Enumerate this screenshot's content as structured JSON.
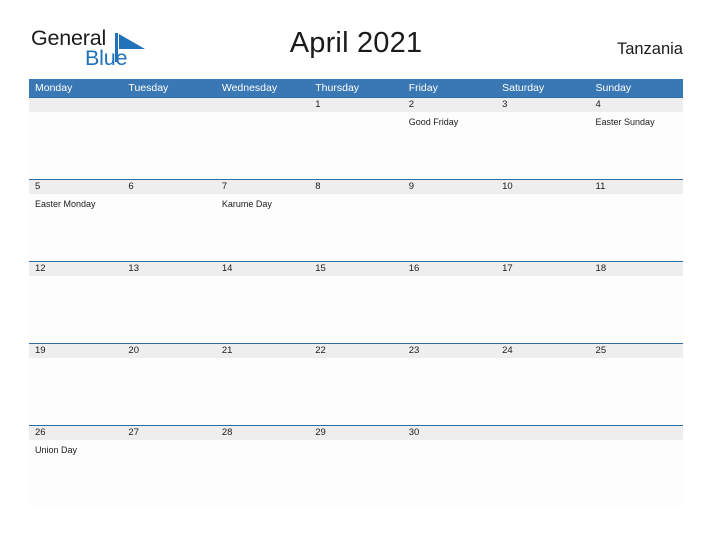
{
  "brand": {
    "name_part1": "General",
    "name_part2": "Blue",
    "mark": "triangle-icon",
    "accent_color": "#2272b9"
  },
  "header": {
    "title": "April 2021",
    "country": "Tanzania"
  },
  "theme": {
    "header_blue": "#3a77b5",
    "row_divider_blue": "#2e6da4",
    "date_strip_gray": "#eeeeee"
  },
  "calendar": {
    "weekdays": [
      "Monday",
      "Tuesday",
      "Wednesday",
      "Thursday",
      "Friday",
      "Saturday",
      "Sunday"
    ],
    "weeks": [
      {
        "days": [
          {
            "number": "",
            "event": ""
          },
          {
            "number": "",
            "event": ""
          },
          {
            "number": "",
            "event": ""
          },
          {
            "number": "1",
            "event": ""
          },
          {
            "number": "2",
            "event": "Good Friday"
          },
          {
            "number": "3",
            "event": ""
          },
          {
            "number": "4",
            "event": "Easter Sunday"
          }
        ]
      },
      {
        "days": [
          {
            "number": "5",
            "event": "Easter Monday"
          },
          {
            "number": "6",
            "event": ""
          },
          {
            "number": "7",
            "event": "Karume Day"
          },
          {
            "number": "8",
            "event": ""
          },
          {
            "number": "9",
            "event": ""
          },
          {
            "number": "10",
            "event": ""
          },
          {
            "number": "11",
            "event": ""
          }
        ]
      },
      {
        "days": [
          {
            "number": "12",
            "event": ""
          },
          {
            "number": "13",
            "event": ""
          },
          {
            "number": "14",
            "event": ""
          },
          {
            "number": "15",
            "event": ""
          },
          {
            "number": "16",
            "event": ""
          },
          {
            "number": "17",
            "event": ""
          },
          {
            "number": "18",
            "event": ""
          }
        ]
      },
      {
        "days": [
          {
            "number": "19",
            "event": ""
          },
          {
            "number": "20",
            "event": ""
          },
          {
            "number": "21",
            "event": ""
          },
          {
            "number": "22",
            "event": ""
          },
          {
            "number": "23",
            "event": ""
          },
          {
            "number": "24",
            "event": ""
          },
          {
            "number": "25",
            "event": ""
          }
        ]
      },
      {
        "days": [
          {
            "number": "26",
            "event": "Union Day"
          },
          {
            "number": "27",
            "event": ""
          },
          {
            "number": "28",
            "event": ""
          },
          {
            "number": "29",
            "event": ""
          },
          {
            "number": "30",
            "event": ""
          },
          {
            "number": "",
            "event": ""
          },
          {
            "number": "",
            "event": ""
          }
        ]
      }
    ]
  }
}
